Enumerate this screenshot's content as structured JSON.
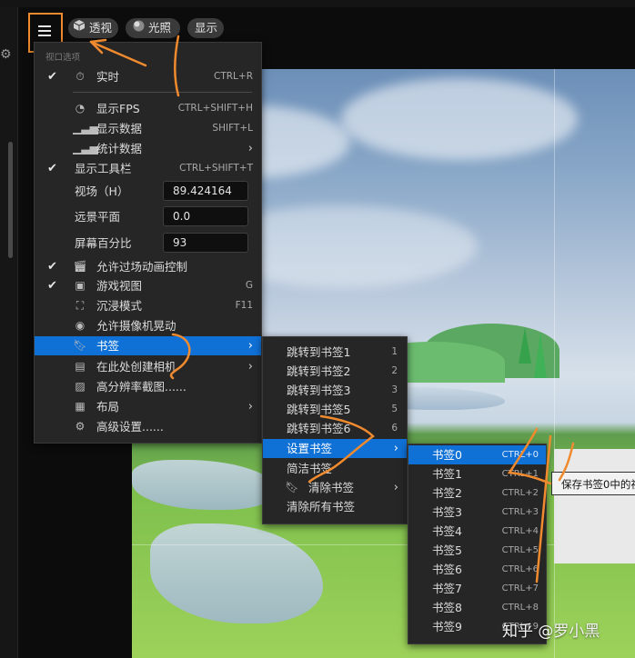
{
  "toolbar": {
    "perspective_label": "透视",
    "lighting_label": "光照",
    "show_label": "显示"
  },
  "viewport_menu": {
    "section_title": "视口选项",
    "items": [
      {
        "label": "实时",
        "shortcut": "CTRL+R",
        "checked": true,
        "icon": "stopwatch-icon"
      },
      {
        "label": "显示FPS",
        "shortcut": "CTRL+SHIFT+H",
        "checked": false,
        "icon": "gauge-icon"
      },
      {
        "label": "显示数据",
        "shortcut": "SHIFT+L",
        "checked": false,
        "icon": "bar-chart-icon"
      },
      {
        "label": "统计数据",
        "shortcut": "",
        "checked": false,
        "icon": "bar-chart-icon",
        "submenu": true
      },
      {
        "label": "显示工具栏",
        "shortcut": "CTRL+SHIFT+T",
        "checked": true
      },
      {
        "label": "允许过场动画控制",
        "shortcut": "",
        "checked": true,
        "icon": "clapperboard-icon"
      },
      {
        "label": "游戏视图",
        "shortcut": "G",
        "checked": true,
        "icon": "image-icon"
      },
      {
        "label": "沉浸模式",
        "shortcut": "F11",
        "checked": false,
        "icon": "fullscreen-icon"
      },
      {
        "label": "允许摄像机晃动",
        "shortcut": "",
        "checked": false,
        "icon": "camera-shake-icon"
      },
      {
        "label": "书签",
        "shortcut": "",
        "checked": false,
        "icon": "bookmark-icon",
        "submenu": true,
        "highlighted": true
      },
      {
        "label": "在此处创建相机",
        "shortcut": "",
        "checked": false,
        "icon": "camera-icon",
        "submenu": true
      },
      {
        "label": "高分辨率截图......",
        "shortcut": "",
        "checked": false,
        "icon": "screenshot-icon"
      },
      {
        "label": "布局",
        "shortcut": "",
        "checked": false,
        "icon": "layout-icon",
        "submenu": true
      },
      {
        "label": "高级设置......",
        "shortcut": "",
        "checked": false,
        "icon": "gear-icon"
      }
    ],
    "fields": [
      {
        "label": "视场（H）",
        "value": "89.424164"
      },
      {
        "label": "远景平面",
        "value": "0.0"
      },
      {
        "label": "屏幕百分比",
        "value": "93"
      }
    ]
  },
  "bookmark_menu": {
    "items": [
      {
        "label": "跳转到书签1",
        "shortcut": "1"
      },
      {
        "label": "跳转到书签2",
        "shortcut": "2"
      },
      {
        "label": "跳转到书签3",
        "shortcut": "3"
      },
      {
        "label": "跳转到书签5",
        "shortcut": "5"
      },
      {
        "label": "跳转到书签6",
        "shortcut": "6"
      },
      {
        "label": "设置书签",
        "shortcut": "",
        "submenu": true,
        "highlighted": true
      },
      {
        "label": "简洁书签",
        "shortcut": ""
      },
      {
        "label": "清除书签",
        "shortcut": "",
        "submenu": true,
        "icon": "bookmark-icon"
      },
      {
        "label": "清除所有书签",
        "shortcut": ""
      }
    ]
  },
  "set_bookmark_menu": {
    "items": [
      {
        "label": "书签0",
        "shortcut": "CTRL+0",
        "highlighted": true
      },
      {
        "label": "书签1",
        "shortcut": "CTRL+1"
      },
      {
        "label": "书签2",
        "shortcut": "CTRL+2"
      },
      {
        "label": "书签3",
        "shortcut": "CTRL+3"
      },
      {
        "label": "书签4",
        "shortcut": "CTRL+4"
      },
      {
        "label": "书签5",
        "shortcut": "CTRL+5"
      },
      {
        "label": "书签6",
        "shortcut": "CTRL+6"
      },
      {
        "label": "书签7",
        "shortcut": "CTRL+7"
      },
      {
        "label": "书签8",
        "shortcut": "CTRL+8"
      },
      {
        "label": "书签9",
        "shortcut": "CTRL+9"
      }
    ]
  },
  "tooltip": {
    "text": "保存书签0中的视"
  },
  "watermark": {
    "text": "知乎 @罗小黑"
  },
  "colors": {
    "highlight": "#0f70d6",
    "annotation": "#f08a2e",
    "menu_bg": "#262626"
  }
}
